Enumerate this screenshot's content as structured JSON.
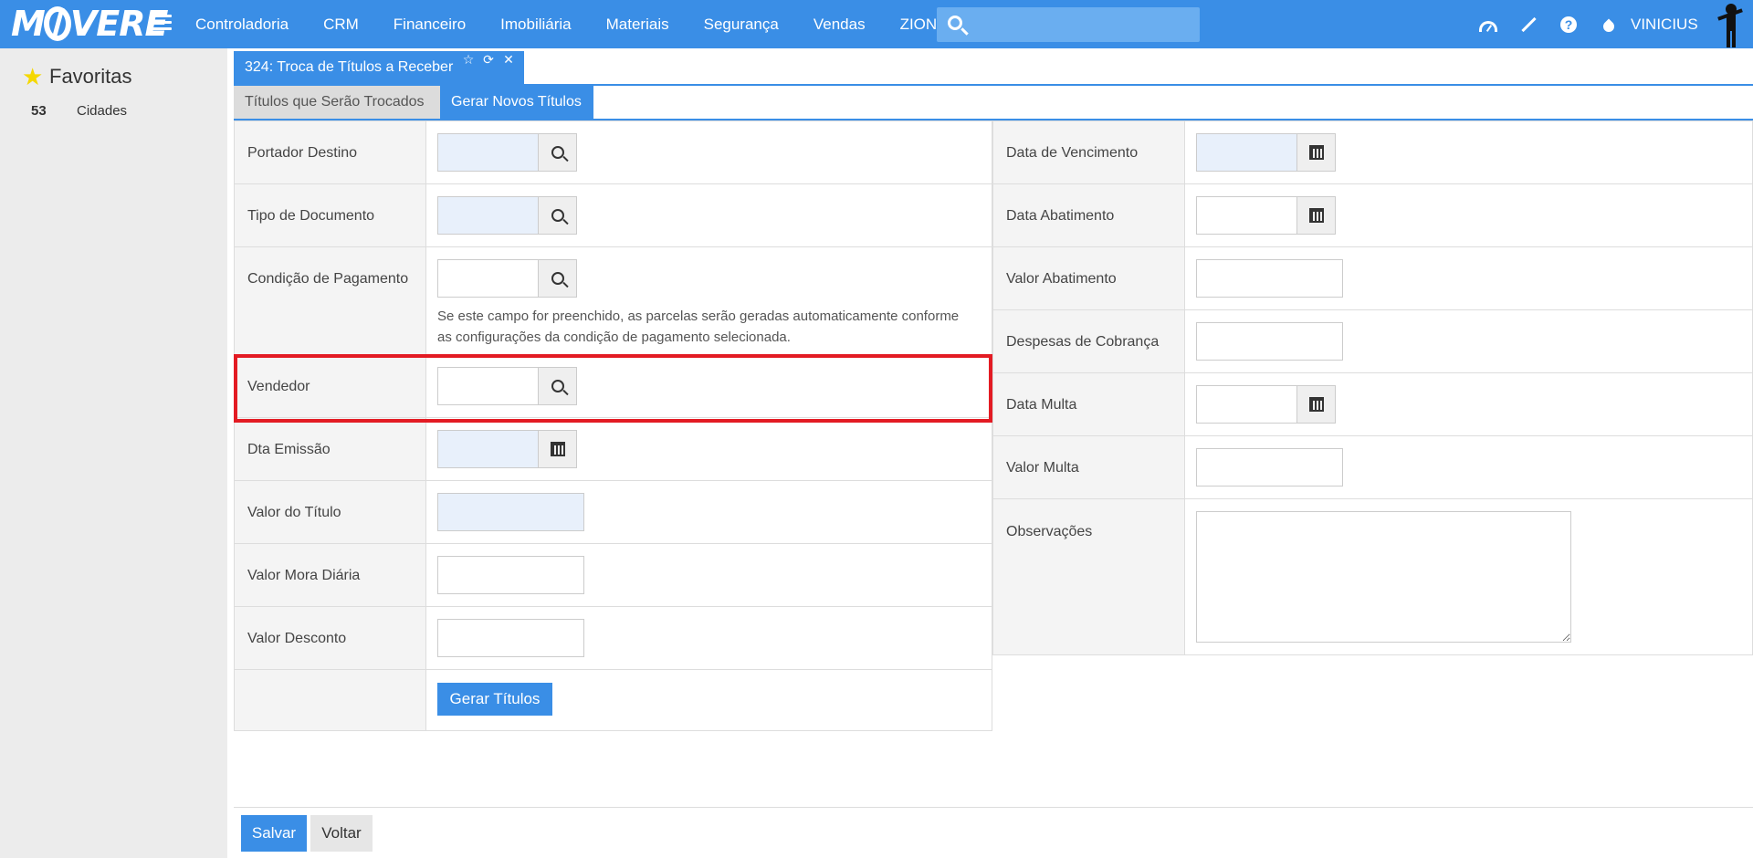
{
  "app": {
    "logo_text": "MOVERE",
    "menu": [
      "Controladoria",
      "CRM",
      "Financeiro",
      "Imobiliária",
      "Materiais",
      "Segurança",
      "Vendas",
      "ZION"
    ],
    "search_value": "",
    "username": "VINICIUS"
  },
  "sidebar": {
    "title": "Favoritas",
    "items": [
      {
        "num": "53",
        "label": "Cidades"
      }
    ]
  },
  "window": {
    "title": "324: Troca de Títulos a Receber",
    "tabs": [
      "Títulos que Serão Trocados",
      "Gerar Novos Títulos"
    ],
    "active_tab": "Gerar Novos Títulos"
  },
  "form_left": {
    "portador_destino": "Portador Destino",
    "tipo_documento": "Tipo de Documento",
    "condicao_pagamento": "Condição de Pagamento",
    "condicao_hint": "Se este campo for preenchido, as parcelas serão geradas automaticamente conforme as configurações da condição de pagamento selecionada.",
    "vendedor": "Vendedor",
    "dta_emissao": "Dta Emissão",
    "valor_titulo": "Valor do Título",
    "valor_mora": "Valor Mora Diária",
    "valor_desconto": "Valor Desconto",
    "gerar_button": "Gerar Títulos"
  },
  "form_right": {
    "data_vencimento": "Data de Vencimento",
    "data_abatimento": "Data Abatimento",
    "valor_abatimento": "Valor Abatimento",
    "despesas_cobranca": "Despesas de Cobrança",
    "data_multa": "Data Multa",
    "valor_multa": "Valor Multa",
    "observacoes": "Observações"
  },
  "footer": {
    "save": "Salvar",
    "back": "Voltar"
  },
  "colors": {
    "accent": "#3a8ee6",
    "highlight": "#e31b23",
    "required_field": "#e8f0fb"
  }
}
